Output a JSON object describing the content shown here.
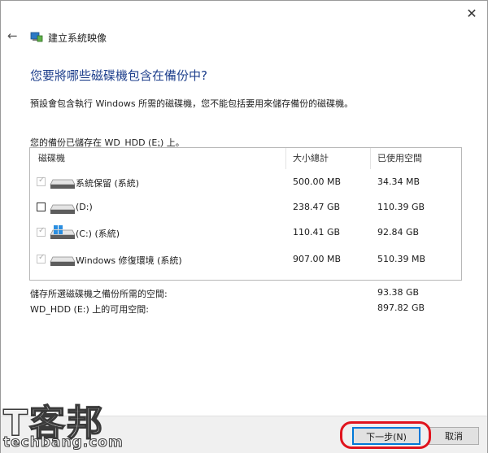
{
  "window": {
    "title": "建立系統映像"
  },
  "heading": "您要將哪些磁碟機包含在備份中?",
  "description": "預設會包含執行 Windows 所需的磁碟機，您不能包括要用來儲存備份的磁碟機。",
  "saved_to": "您的備份已儲存在 WD_HDD (E:) 上。",
  "table": {
    "headers": [
      "磁碟機",
      "大小總計",
      "已使用空間"
    ],
    "rows": [
      {
        "name": "系統保留 (系統)",
        "size": "500.00 MB",
        "used": "34.34 MB",
        "checked": true,
        "disabled": true,
        "icon": "drive-icon"
      },
      {
        "name": "(D:)",
        "size": "238.47 GB",
        "used": "110.39 GB",
        "checked": false,
        "disabled": false,
        "icon": "drive-icon"
      },
      {
        "name": "(C:) (系統)",
        "size": "110.41 GB",
        "used": "92.84 GB",
        "checked": true,
        "disabled": true,
        "icon": "windows-drive-icon"
      },
      {
        "name": "Windows 修復環境 (系統)",
        "size": "907.00 MB",
        "used": "510.39 MB",
        "checked": true,
        "disabled": true,
        "icon": "drive-icon"
      }
    ]
  },
  "summary": {
    "required_label": "儲存所選磁碟機之備份所需的空間:",
    "required_value": "93.38 GB",
    "free_label": "WD_HDD (E:) 上的可用空間:",
    "free_value": "897.82 GB"
  },
  "buttons": {
    "next": "下一步(N)",
    "cancel": "取消"
  },
  "watermark": {
    "big": "T客邦",
    "small": "techbang.com"
  },
  "colors": {
    "heading": "#1e3f8c",
    "highlight": "#e0141e",
    "button_focus": "#0078d7"
  }
}
